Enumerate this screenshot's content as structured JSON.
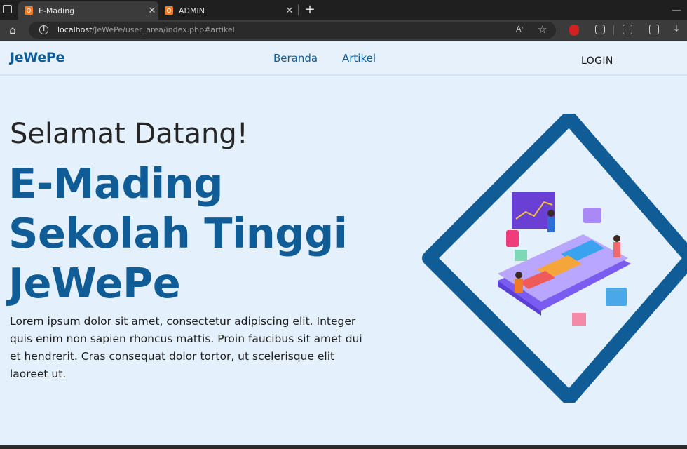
{
  "browser": {
    "tabs": [
      {
        "title": "E-Mading",
        "close": "✕"
      },
      {
        "title": "ADMIN",
        "close": "✕"
      }
    ],
    "new_tab": "+",
    "minimize": "—",
    "url_host": "localhost",
    "url_path": "/JeWePe/user_area/index.php#artikel",
    "read_aloud": "A⁾"
  },
  "navbar": {
    "brand": "JeWePe",
    "links": [
      "Beranda",
      "Artikel"
    ],
    "login": "LOGIN"
  },
  "hero": {
    "greeting": "Selamat Datang!",
    "headline_lines": [
      "E-Mading",
      "Sekolah Tinggi",
      "JeWePe"
    ],
    "description": "Lorem ipsum dolor sit amet, consectetur adipiscing elit. Integer quis enim non sapien rhoncus mattis. Proin faucibus sit amet dui et hendrerit. Cras consequat dolor tortor, ut scelerisque elit laoreet ut."
  },
  "colors": {
    "brand_blue": "#0f5c96",
    "page_bg": "#e4f0fb"
  },
  "icons": {
    "home": "home-icon",
    "info": "info-icon",
    "star": "favorite-star-icon",
    "download": "download-icon"
  }
}
